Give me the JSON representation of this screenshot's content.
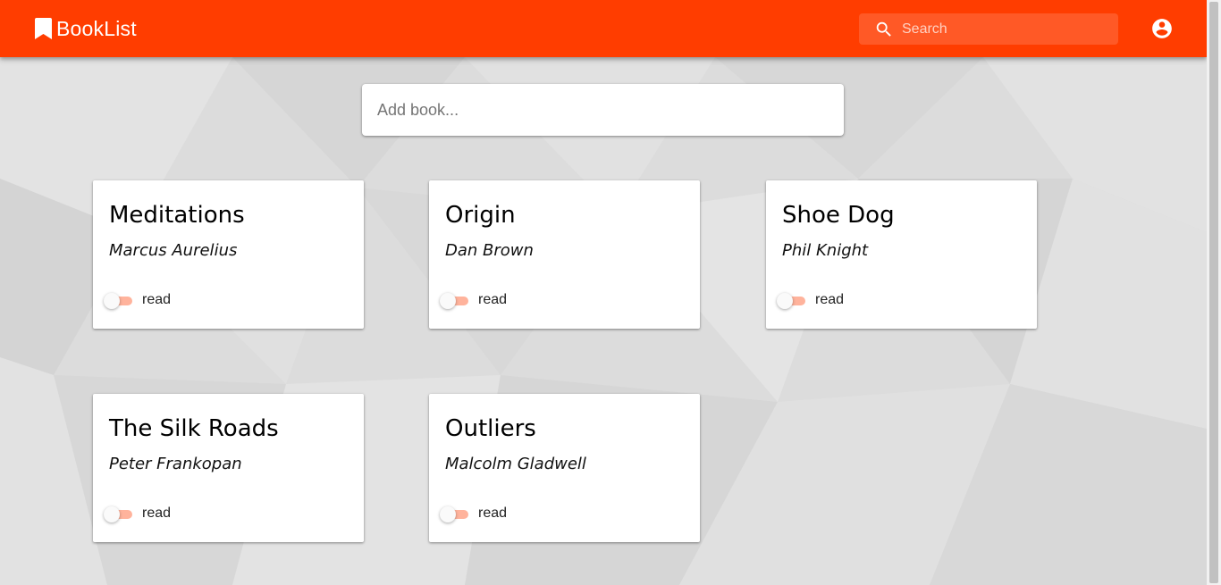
{
  "app": {
    "name": "BookList",
    "brand_color": "#ff3d00",
    "icon": "bookmark-icon"
  },
  "search": {
    "placeholder": "Search",
    "value": "",
    "icon": "search-icon"
  },
  "account": {
    "icon": "account-circle-icon"
  },
  "add_book": {
    "placeholder": "Add book...",
    "value": ""
  },
  "books": [
    {
      "title": "Meditations",
      "author": "Marcus Aurelius",
      "read_label": "read",
      "read": false
    },
    {
      "title": "Origin",
      "author": "Dan Brown",
      "read_label": "read",
      "read": false
    },
    {
      "title": "Shoe Dog",
      "author": "Phil Knight",
      "read_label": "read",
      "read": false
    },
    {
      "title": "The Silk Roads",
      "author": "Peter Frankopan",
      "read_label": "read",
      "read": false
    },
    {
      "title": "Outliers",
      "author": "Malcolm Gladwell",
      "read_label": "read",
      "read": false
    }
  ]
}
